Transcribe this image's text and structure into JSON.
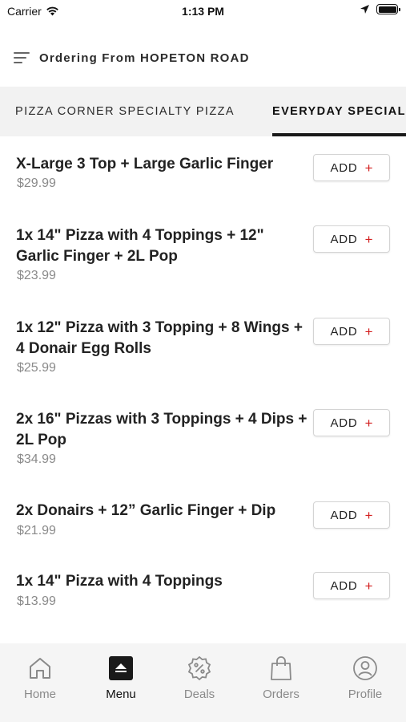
{
  "status_bar": {
    "carrier": "Carrier",
    "time": "1:13 PM"
  },
  "header": {
    "title": "Ordering From HOPETON ROAD"
  },
  "tabs": [
    {
      "label": "PIZZA CORNER SPECIALTY PIZZA",
      "active": false
    },
    {
      "label": "EVERYDAY SPECIALS",
      "active": true
    }
  ],
  "items": [
    {
      "name": "X-Large 3 Top + Large Garlic Finger",
      "price": "$29.99",
      "add_label": "ADD"
    },
    {
      "name": "1x 14\" Pizza with 4 Toppings + 12\" Garlic Finger + 2L Pop",
      "price": "$23.99",
      "add_label": "ADD"
    },
    {
      "name": "1x 12\" Pizza with 3 Topping + 8 Wings + 4 Donair Egg Rolls",
      "price": "$25.99",
      "add_label": "ADD"
    },
    {
      "name": "2x 16\" Pizzas with 3 Toppings + 4 Dips + 2L Pop",
      "price": "$34.99",
      "add_label": "ADD"
    },
    {
      "name": "2x Donairs + 12” Garlic Finger + Dip",
      "price": "$21.99",
      "add_label": "ADD"
    },
    {
      "name": "1x 14\" Pizza with 4 Toppings",
      "price": "$13.99",
      "add_label": "ADD"
    }
  ],
  "nav": [
    {
      "label": "Home",
      "icon": "home-icon",
      "active": false
    },
    {
      "label": "Menu",
      "icon": "menu-icon",
      "active": true
    },
    {
      "label": "Deals",
      "icon": "deals-icon",
      "active": false
    },
    {
      "label": "Orders",
      "icon": "orders-icon",
      "active": false
    },
    {
      "label": "Profile",
      "icon": "profile-icon",
      "active": false
    }
  ],
  "colors": {
    "accent_plus": "#d32020",
    "active_tab": "#1a1a1a",
    "price_gray": "#8a8a8a"
  }
}
